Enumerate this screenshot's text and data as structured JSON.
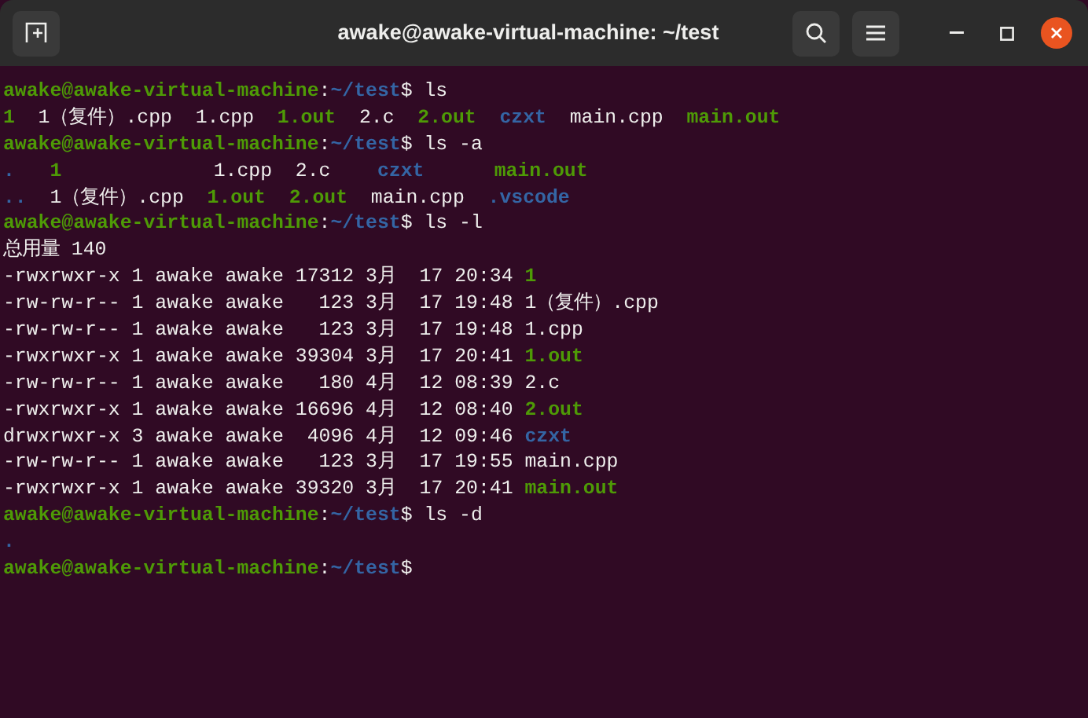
{
  "window": {
    "title": "awake@awake-virtual-machine: ~/test"
  },
  "terminal": {
    "lines": [
      {
        "segments": [
          {
            "text": "awake@awake-virtual-machine",
            "kind": "user"
          },
          {
            "text": ":",
            "kind": "plain"
          },
          {
            "text": "~/test",
            "kind": "path"
          },
          {
            "text": "$ ls",
            "kind": "plain"
          }
        ]
      },
      {
        "segments": [
          {
            "text": "1",
            "kind": "exec"
          },
          {
            "text": "  1（复件）.cpp  1.cpp  ",
            "kind": "plain"
          },
          {
            "text": "1.out",
            "kind": "exec"
          },
          {
            "text": "  2.c  ",
            "kind": "plain"
          },
          {
            "text": "2.out  ",
            "kind": "exec"
          },
          {
            "text": "czxt",
            "kind": "dir"
          },
          {
            "text": "  main.cpp  ",
            "kind": "plain"
          },
          {
            "text": "main.out",
            "kind": "exec"
          }
        ]
      },
      {
        "segments": [
          {
            "text": "awake@awake-virtual-machine",
            "kind": "user"
          },
          {
            "text": ":",
            "kind": "plain"
          },
          {
            "text": "~/test",
            "kind": "path"
          },
          {
            "text": "$ ls -a",
            "kind": "plain"
          }
        ]
      },
      {
        "segments": [
          {
            "text": ".   ",
            "kind": "dir"
          },
          {
            "text": "1",
            "kind": "exec"
          },
          {
            "text": "             1.cpp  2.c    ",
            "kind": "plain"
          },
          {
            "text": "czxt      ",
            "kind": "dir"
          },
          {
            "text": "main.out",
            "kind": "exec"
          }
        ]
      },
      {
        "segments": [
          {
            "text": "..",
            "kind": "dir"
          },
          {
            "text": "  1（复件）.cpp  ",
            "kind": "plain"
          },
          {
            "text": "1.out  ",
            "kind": "exec"
          },
          {
            "text": "2.out",
            "kind": "exec"
          },
          {
            "text": "  main.cpp  ",
            "kind": "plain"
          },
          {
            "text": ".vscode",
            "kind": "dir"
          }
        ]
      },
      {
        "segments": [
          {
            "text": "awake@awake-virtual-machine",
            "kind": "user"
          },
          {
            "text": ":",
            "kind": "plain"
          },
          {
            "text": "~/test",
            "kind": "path"
          },
          {
            "text": "$ ls -l",
            "kind": "plain"
          }
        ]
      },
      {
        "segments": [
          {
            "text": "总用量 140",
            "kind": "plain"
          }
        ]
      },
      {
        "segments": [
          {
            "text": "-rwxrwxr-x 1 awake awake 17312 3月  17 20:34 ",
            "kind": "plain"
          },
          {
            "text": "1",
            "kind": "exec"
          }
        ]
      },
      {
        "segments": [
          {
            "text": "-rw-rw-r-- 1 awake awake   123 3月  17 19:48 1（复件）.cpp",
            "kind": "plain"
          }
        ]
      },
      {
        "segments": [
          {
            "text": "-rw-rw-r-- 1 awake awake   123 3月  17 19:48 1.cpp",
            "kind": "plain"
          }
        ]
      },
      {
        "segments": [
          {
            "text": "-rwxrwxr-x 1 awake awake 39304 3月  17 20:41 ",
            "kind": "plain"
          },
          {
            "text": "1.out",
            "kind": "exec"
          }
        ]
      },
      {
        "segments": [
          {
            "text": "-rw-rw-r-- 1 awake awake   180 4月  12 08:39 2.c",
            "kind": "plain"
          }
        ]
      },
      {
        "segments": [
          {
            "text": "-rwxrwxr-x 1 awake awake 16696 4月  12 08:40 ",
            "kind": "plain"
          },
          {
            "text": "2.out",
            "kind": "exec"
          }
        ]
      },
      {
        "segments": [
          {
            "text": "drwxrwxr-x 3 awake awake  4096 4月  12 09:46 ",
            "kind": "plain"
          },
          {
            "text": "czxt",
            "kind": "dir"
          }
        ]
      },
      {
        "segments": [
          {
            "text": "-rw-rw-r-- 1 awake awake   123 3月  17 19:55 main.cpp",
            "kind": "plain"
          }
        ]
      },
      {
        "segments": [
          {
            "text": "-rwxrwxr-x 1 awake awake 39320 3月  17 20:41 ",
            "kind": "plain"
          },
          {
            "text": "main.out",
            "kind": "exec"
          }
        ]
      },
      {
        "segments": [
          {
            "text": "awake@awake-virtual-machine",
            "kind": "user"
          },
          {
            "text": ":",
            "kind": "plain"
          },
          {
            "text": "~/test",
            "kind": "path"
          },
          {
            "text": "$ ls -d",
            "kind": "plain"
          }
        ]
      },
      {
        "segments": [
          {
            "text": ".",
            "kind": "dir"
          }
        ]
      },
      {
        "segments": [
          {
            "text": "awake@awake-virtual-machine",
            "kind": "user"
          },
          {
            "text": ":",
            "kind": "plain"
          },
          {
            "text": "~/test",
            "kind": "path"
          },
          {
            "text": "$",
            "kind": "plain"
          }
        ]
      }
    ]
  }
}
